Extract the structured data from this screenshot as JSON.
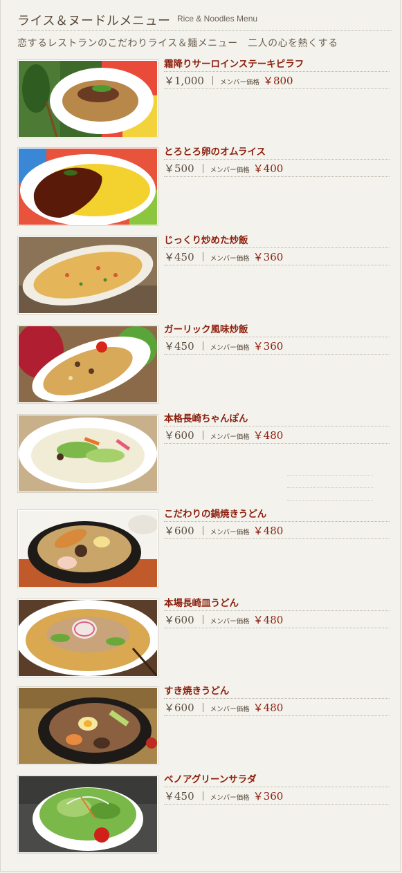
{
  "header": {
    "title_jp": "ライス＆ヌードルメニュー",
    "title_en": "Rice & Noodles Menu",
    "subtitle": "恋するレストランのこだわりライス＆麺メニュー　二人の心を熱くする"
  },
  "member_label": "メンバー価格",
  "items": [
    {
      "name": "霜降りサーロインステーキピラフ",
      "price": "￥1,000",
      "member_price": "￥800",
      "photo": "steak-pilaf"
    },
    {
      "name": "とろとろ卵のオムライス",
      "price": "￥500",
      "member_price": "￥400",
      "photo": "omurice"
    },
    {
      "name": "じっくり炒めた炒飯",
      "price": "￥450",
      "member_price": "￥360",
      "photo": "fried-rice"
    },
    {
      "name": "ガーリック風味炒飯",
      "price": "￥450",
      "member_price": "￥360",
      "photo": "garlic-fried-rice"
    },
    {
      "name": "本格長崎ちゃんぽん",
      "price": "￥600",
      "member_price": "￥480",
      "photo": "champon"
    },
    {
      "name": "こだわりの鍋焼きうどん",
      "price": "￥600",
      "member_price": "￥480",
      "photo": "nabeyaki-udon"
    },
    {
      "name": "本場長崎皿うどん",
      "price": "￥600",
      "member_price": "￥480",
      "photo": "sara-udon"
    },
    {
      "name": "すき焼きうどん",
      "price": "￥600",
      "member_price": "￥480",
      "photo": "sukiyaki-udon"
    },
    {
      "name": "ベノアグリーンサラダ",
      "price": "￥450",
      "member_price": "￥360",
      "photo": "green-salad"
    }
  ]
}
